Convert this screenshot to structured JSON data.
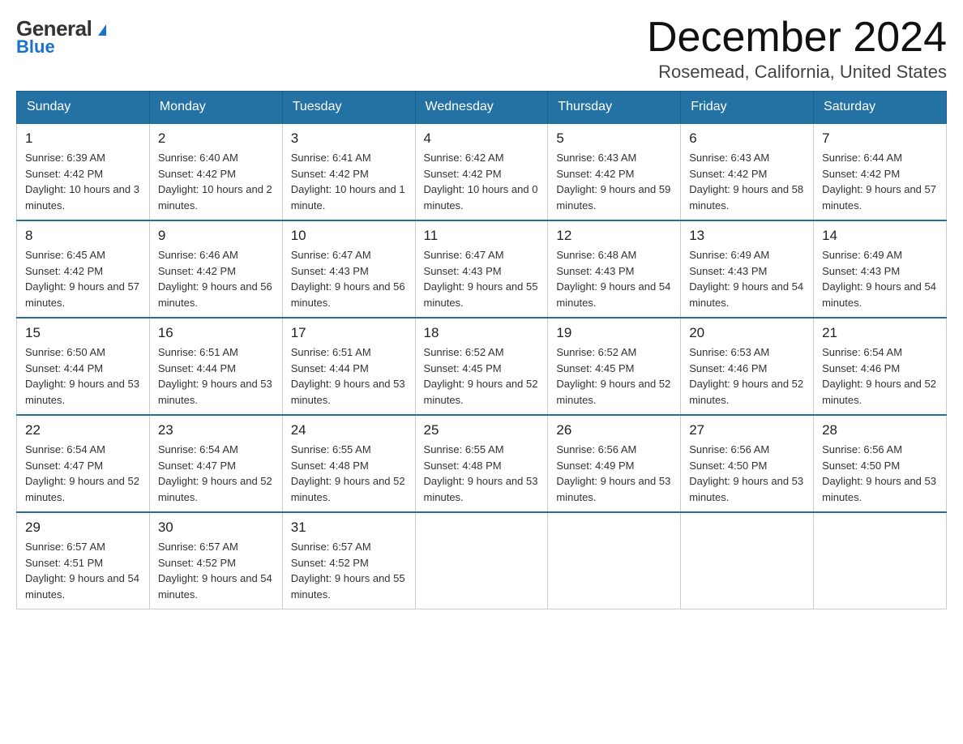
{
  "logo": {
    "general": "General",
    "blue": "Blue",
    "arrow": "▶"
  },
  "title": {
    "month_year": "December 2024",
    "location": "Rosemead, California, United States"
  },
  "days_of_week": [
    "Sunday",
    "Monday",
    "Tuesday",
    "Wednesday",
    "Thursday",
    "Friday",
    "Saturday"
  ],
  "weeks": [
    [
      {
        "day": "1",
        "sunrise": "6:39 AM",
        "sunset": "4:42 PM",
        "daylight": "10 hours and 3 minutes."
      },
      {
        "day": "2",
        "sunrise": "6:40 AM",
        "sunset": "4:42 PM",
        "daylight": "10 hours and 2 minutes."
      },
      {
        "day": "3",
        "sunrise": "6:41 AM",
        "sunset": "4:42 PM",
        "daylight": "10 hours and 1 minute."
      },
      {
        "day": "4",
        "sunrise": "6:42 AM",
        "sunset": "4:42 PM",
        "daylight": "10 hours and 0 minutes."
      },
      {
        "day": "5",
        "sunrise": "6:43 AM",
        "sunset": "4:42 PM",
        "daylight": "9 hours and 59 minutes."
      },
      {
        "day": "6",
        "sunrise": "6:43 AM",
        "sunset": "4:42 PM",
        "daylight": "9 hours and 58 minutes."
      },
      {
        "day": "7",
        "sunrise": "6:44 AM",
        "sunset": "4:42 PM",
        "daylight": "9 hours and 57 minutes."
      }
    ],
    [
      {
        "day": "8",
        "sunrise": "6:45 AM",
        "sunset": "4:42 PM",
        "daylight": "9 hours and 57 minutes."
      },
      {
        "day": "9",
        "sunrise": "6:46 AM",
        "sunset": "4:42 PM",
        "daylight": "9 hours and 56 minutes."
      },
      {
        "day": "10",
        "sunrise": "6:47 AM",
        "sunset": "4:43 PM",
        "daylight": "9 hours and 56 minutes."
      },
      {
        "day": "11",
        "sunrise": "6:47 AM",
        "sunset": "4:43 PM",
        "daylight": "9 hours and 55 minutes."
      },
      {
        "day": "12",
        "sunrise": "6:48 AM",
        "sunset": "4:43 PM",
        "daylight": "9 hours and 54 minutes."
      },
      {
        "day": "13",
        "sunrise": "6:49 AM",
        "sunset": "4:43 PM",
        "daylight": "9 hours and 54 minutes."
      },
      {
        "day": "14",
        "sunrise": "6:49 AM",
        "sunset": "4:43 PM",
        "daylight": "9 hours and 54 minutes."
      }
    ],
    [
      {
        "day": "15",
        "sunrise": "6:50 AM",
        "sunset": "4:44 PM",
        "daylight": "9 hours and 53 minutes."
      },
      {
        "day": "16",
        "sunrise": "6:51 AM",
        "sunset": "4:44 PM",
        "daylight": "9 hours and 53 minutes."
      },
      {
        "day": "17",
        "sunrise": "6:51 AM",
        "sunset": "4:44 PM",
        "daylight": "9 hours and 53 minutes."
      },
      {
        "day": "18",
        "sunrise": "6:52 AM",
        "sunset": "4:45 PM",
        "daylight": "9 hours and 52 minutes."
      },
      {
        "day": "19",
        "sunrise": "6:52 AM",
        "sunset": "4:45 PM",
        "daylight": "9 hours and 52 minutes."
      },
      {
        "day": "20",
        "sunrise": "6:53 AM",
        "sunset": "4:46 PM",
        "daylight": "9 hours and 52 minutes."
      },
      {
        "day": "21",
        "sunrise": "6:54 AM",
        "sunset": "4:46 PM",
        "daylight": "9 hours and 52 minutes."
      }
    ],
    [
      {
        "day": "22",
        "sunrise": "6:54 AM",
        "sunset": "4:47 PM",
        "daylight": "9 hours and 52 minutes."
      },
      {
        "day": "23",
        "sunrise": "6:54 AM",
        "sunset": "4:47 PM",
        "daylight": "9 hours and 52 minutes."
      },
      {
        "day": "24",
        "sunrise": "6:55 AM",
        "sunset": "4:48 PM",
        "daylight": "9 hours and 52 minutes."
      },
      {
        "day": "25",
        "sunrise": "6:55 AM",
        "sunset": "4:48 PM",
        "daylight": "9 hours and 53 minutes."
      },
      {
        "day": "26",
        "sunrise": "6:56 AM",
        "sunset": "4:49 PM",
        "daylight": "9 hours and 53 minutes."
      },
      {
        "day": "27",
        "sunrise": "6:56 AM",
        "sunset": "4:50 PM",
        "daylight": "9 hours and 53 minutes."
      },
      {
        "day": "28",
        "sunrise": "6:56 AM",
        "sunset": "4:50 PM",
        "daylight": "9 hours and 53 minutes."
      }
    ],
    [
      {
        "day": "29",
        "sunrise": "6:57 AM",
        "sunset": "4:51 PM",
        "daylight": "9 hours and 54 minutes."
      },
      {
        "day": "30",
        "sunrise": "6:57 AM",
        "sunset": "4:52 PM",
        "daylight": "9 hours and 54 minutes."
      },
      {
        "day": "31",
        "sunrise": "6:57 AM",
        "sunset": "4:52 PM",
        "daylight": "9 hours and 55 minutes."
      },
      null,
      null,
      null,
      null
    ]
  ],
  "labels": {
    "sunrise_prefix": "Sunrise: ",
    "sunset_prefix": "Sunset: ",
    "daylight_prefix": "Daylight: "
  }
}
